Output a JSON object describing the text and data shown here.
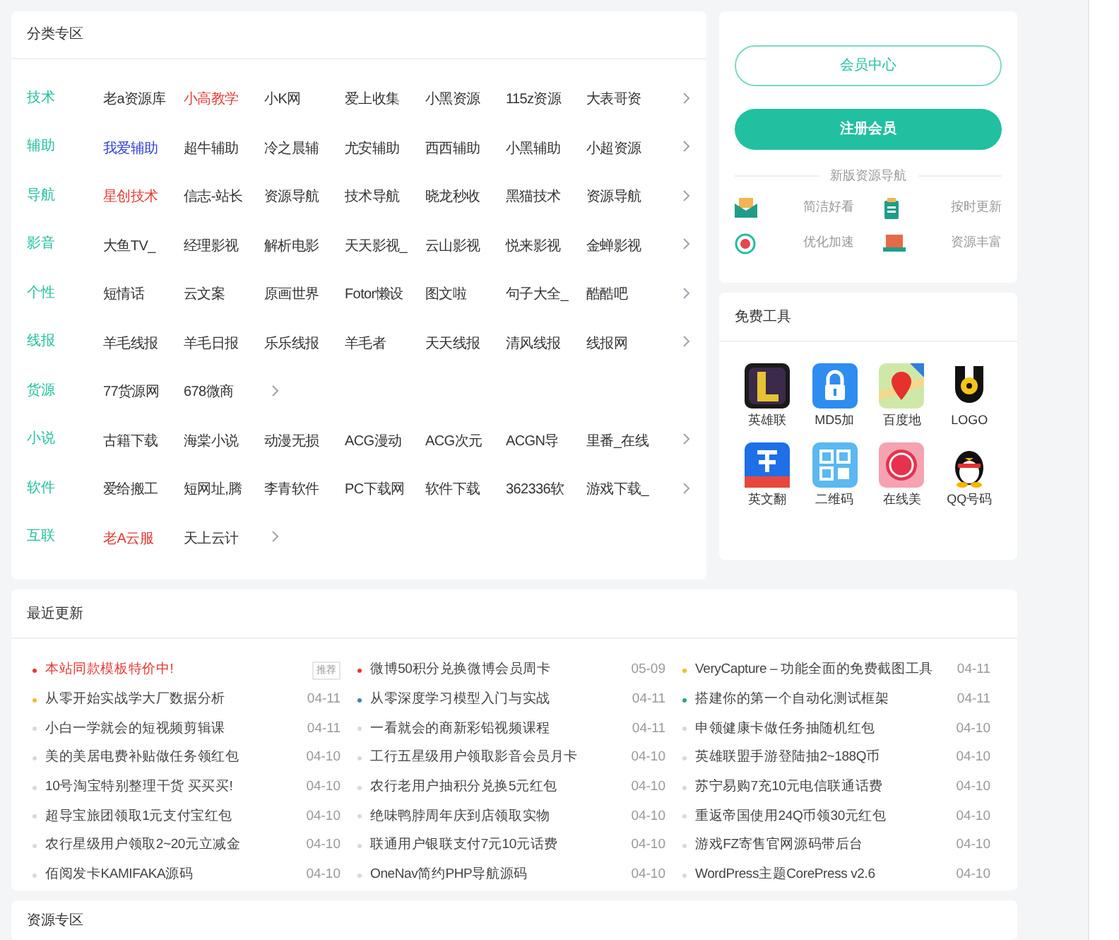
{
  "categories": {
    "title": "分类专区",
    "rows": [
      {
        "label": "技术",
        "items": [
          {
            "text": "老a资源库"
          },
          {
            "text": "小高教学",
            "color": "#e53935"
          },
          {
            "text": "小K网"
          },
          {
            "text": "爱上收集"
          },
          {
            "text": "小黑资源"
          },
          {
            "text": "115z资源"
          },
          {
            "text": "大表哥资"
          }
        ]
      },
      {
        "label": "辅助",
        "items": [
          {
            "text": "我爱辅助",
            "color": "#2f3fd6"
          },
          {
            "text": "超牛辅助"
          },
          {
            "text": "冷之晨辅"
          },
          {
            "text": "尤安辅助"
          },
          {
            "text": "西西辅助"
          },
          {
            "text": "小黑辅助"
          },
          {
            "text": "小超资源"
          }
        ]
      },
      {
        "label": "导航",
        "items": [
          {
            "text": "星创技术",
            "color": "#e53935"
          },
          {
            "text": "信志-站长"
          },
          {
            "text": "资源导航"
          },
          {
            "text": "技术导航"
          },
          {
            "text": "晓龙秒收"
          },
          {
            "text": "黑猫技术"
          },
          {
            "text": "资源导航"
          }
        ]
      },
      {
        "label": "影音",
        "items": [
          {
            "text": "大鱼TV_"
          },
          {
            "text": "经理影视"
          },
          {
            "text": "解析电影"
          },
          {
            "text": "天天影视_"
          },
          {
            "text": "云山影视"
          },
          {
            "text": "悦来影视"
          },
          {
            "text": "金蝉影视"
          }
        ]
      },
      {
        "label": "个性",
        "items": [
          {
            "text": "短情话"
          },
          {
            "text": "云文案"
          },
          {
            "text": "原画世界"
          },
          {
            "text": "Fotor懒设"
          },
          {
            "text": "图文啦"
          },
          {
            "text": "句子大全_"
          },
          {
            "text": "酷酷吧"
          }
        ]
      },
      {
        "label": "线报",
        "items": [
          {
            "text": "羊毛线报"
          },
          {
            "text": "羊毛日报"
          },
          {
            "text": "乐乐线报"
          },
          {
            "text": "羊毛者"
          },
          {
            "text": "天天线报"
          },
          {
            "text": "清风线报"
          },
          {
            "text": "线报网"
          }
        ]
      },
      {
        "label": "货源",
        "items": [
          {
            "text": "77货源网"
          },
          {
            "text": "678微商"
          }
        ]
      },
      {
        "label": "小说",
        "items": [
          {
            "text": "古籍下载"
          },
          {
            "text": "海棠小说"
          },
          {
            "text": "动漫无损"
          },
          {
            "text": "ACG漫动"
          },
          {
            "text": "ACG次元"
          },
          {
            "text": "ACGN导"
          },
          {
            "text": "里番_在线"
          }
        ]
      },
      {
        "label": "软件",
        "items": [
          {
            "text": "爱给搬工"
          },
          {
            "text": "短网址,腾"
          },
          {
            "text": "李青软件"
          },
          {
            "text": "PC下载网"
          },
          {
            "text": "软件下载"
          },
          {
            "text": "362336软"
          },
          {
            "text": "游戏下载_"
          }
        ]
      },
      {
        "label": "互联",
        "items": [
          {
            "text": "老A云服",
            "color": "#e53935"
          },
          {
            "text": "天上云计"
          }
        ]
      }
    ]
  },
  "member": {
    "buttons": [
      {
        "label": "会员中心",
        "kind": "outline"
      },
      {
        "label": "注册会员",
        "kind": "solid"
      }
    ],
    "divider_title": "新版资源导航",
    "features": [
      {
        "label": "简洁好看"
      },
      {
        "label": "按时更新"
      },
      {
        "label": "优化加速"
      },
      {
        "label": "资源丰富"
      }
    ]
  },
  "tools": {
    "title": "免费工具",
    "items": [
      {
        "label": "英雄联"
      },
      {
        "label": "MD5加"
      },
      {
        "label": "百度地"
      },
      {
        "label": "LOGO"
      },
      {
        "label": "英文翻"
      },
      {
        "label": "二维码"
      },
      {
        "label": "在线美"
      },
      {
        "label": "QQ号码"
      }
    ]
  },
  "updates": {
    "title": "最近更新",
    "columns": [
      [
        {
          "title": "本站同款模板特价中!",
          "color": "#e53935",
          "hot": true,
          "tag": "推荐"
        },
        {
          "title": "从零开始实战学大厂数据分析",
          "color": "#f5b731",
          "date": "04-11"
        },
        {
          "title": "小白一学就会的短视频剪辑课",
          "color": "#d9d9d9",
          "date": "04-11"
        },
        {
          "title": "美的美居电费补贴做任务领红包",
          "color": "#d9d9d9",
          "date": "04-10"
        },
        {
          "title": "10号淘宝特别整理干货 买买买!",
          "color": "#d9d9d9",
          "date": "04-10"
        },
        {
          "title": "超导宝旅团领取1元支付宝红包",
          "color": "#d9d9d9",
          "date": "04-10"
        },
        {
          "title": "农行星级用户领取2~20元立减金",
          "color": "#d9d9d9",
          "date": "04-10"
        },
        {
          "title": "佰阅发卡KAMIFAKA源码",
          "color": "#d9d9d9",
          "date": "04-10"
        }
      ],
      [
        {
          "title": "微博50积分兑换微博会员周卡",
          "color": "#e53935",
          "hot": false,
          "date": "05-09"
        },
        {
          "title": "从零深度学习模型入门与实战",
          "color": "#3b82c4",
          "date": "04-11"
        },
        {
          "title": "一看就会的商新彩铅视频课程",
          "color": "#d9d9d9",
          "date": "04-11"
        },
        {
          "title": "工行五星级用户领取影音会员月卡",
          "color": "#d9d9d9",
          "date": "04-10"
        },
        {
          "title": "农行老用户抽积分兑换5元红包",
          "color": "#d9d9d9",
          "date": "04-10"
        },
        {
          "title": "绝味鸭脖周年庆到店领取实物",
          "color": "#d9d9d9",
          "date": "04-10"
        },
        {
          "title": "联通用户银联支付7元10元话费",
          "color": "#d9d9d9",
          "date": "04-10"
        },
        {
          "title": "OneNav简约PHP导航源码",
          "color": "#d9d9d9",
          "date": "04-10"
        }
      ],
      [
        {
          "title": "VeryCapture – 功能全面的免费截图工具",
          "color": "#f5b731",
          "date": "04-11"
        },
        {
          "title": "搭建你的第一个自动化测试框架",
          "color": "#2aa876",
          "date": "04-11"
        },
        {
          "title": "申领健康卡做任务抽随机红包",
          "color": "#d9d9d9",
          "date": "04-10"
        },
        {
          "title": "英雄联盟手游登陆抽2~188Q币",
          "color": "#d9d9d9",
          "date": "04-10"
        },
        {
          "title": "苏宁易购7充10元电信联通话费",
          "color": "#d9d9d9",
          "date": "04-10"
        },
        {
          "title": "重返帝国使用24Q币领30元红包",
          "color": "#d9d9d9",
          "date": "04-10"
        },
        {
          "title": "游戏FZ寄售官网源码带后台",
          "color": "#d9d9d9",
          "date": "04-10"
        },
        {
          "title": "WordPress主题CorePress v2.6",
          "color": "#d9d9d9",
          "date": "04-10"
        }
      ]
    ]
  },
  "resources": {
    "title": "资源专区"
  }
}
